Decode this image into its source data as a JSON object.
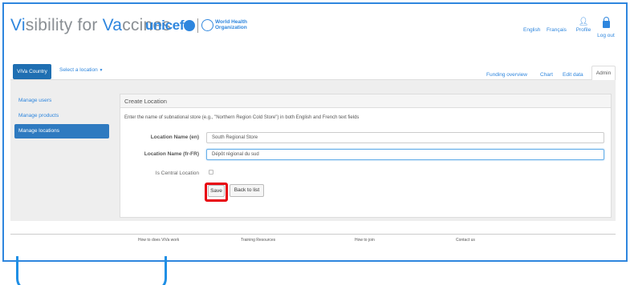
{
  "header": {
    "brand_prefix_1": "Vi",
    "brand_mid_1": "sibility for ",
    "brand_prefix_2": "Va",
    "brand_mid_2": "ccines",
    "unicef": "unicef",
    "who_text": "World Health Organization"
  },
  "top_links": {
    "english": "English",
    "francais": "Français",
    "profile": "Profile",
    "logout": "Log out"
  },
  "nav": {
    "country_button": "ViVa Country",
    "select_location": "Select a location",
    "tabs": [
      "Funding overview",
      "Chart",
      "Edit data"
    ],
    "admin_tab": "Admin"
  },
  "sidebar": {
    "items": [
      {
        "label": "Manage users"
      },
      {
        "label": "Manage products"
      },
      {
        "label": "Manage locations",
        "active": true
      }
    ]
  },
  "panel": {
    "title": "Create Location",
    "instruction": "Enter the name of subnational store (e.g., \"Northern Region Cold Store\") in both English and French text fields",
    "label_en": "Location Name (en)",
    "value_en": "South Regional Store",
    "label_fr": "Location Name (fr-FR)",
    "value_fr": "Dépôt régional du sud",
    "label_central": "Is Central Location",
    "save_label": "Save",
    "back_label": "Back to list"
  },
  "footer": {
    "links": [
      "How to does ViVa work",
      "Training Resources",
      "How to join",
      "Contact us"
    ]
  },
  "colors": {
    "accent": "#2e86de",
    "primary_button": "#1f6fb2",
    "highlight": "#e8000d"
  }
}
